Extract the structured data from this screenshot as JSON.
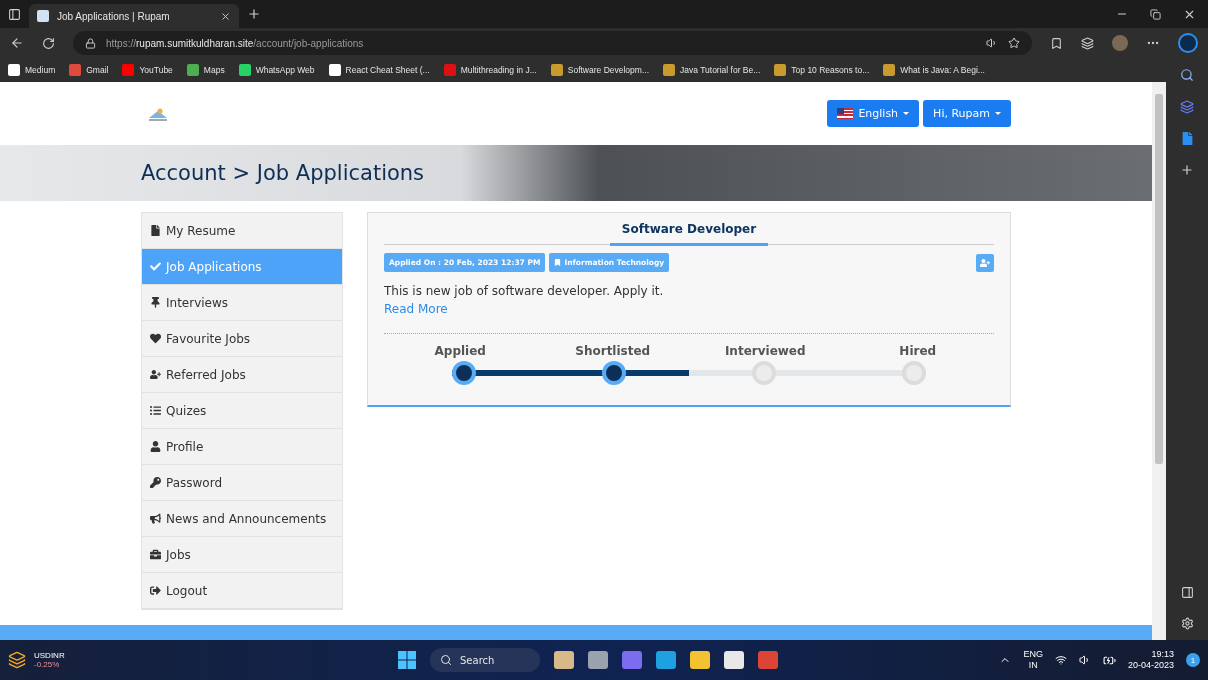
{
  "browser": {
    "tabs": [
      {
        "title": "Job Applications | Rupam",
        "selected": true
      }
    ],
    "url": {
      "scheme": "https://",
      "host": "rupam.sumitkuldharan.site",
      "path": "/account/job-applications"
    },
    "bookmarks": [
      "Medium",
      "Gmail",
      "YouTube",
      "Maps",
      "WhatsApp Web",
      "React Cheat Sheet (...",
      "Multithreading in J...",
      "Software Developm...",
      "Java Tutorial for Be...",
      "Top 10 Reasons to...",
      "What is Java: A Begi..."
    ]
  },
  "header": {
    "language": "English",
    "user": "Hi, Rupam"
  },
  "banner": {
    "breadcrumb": "Account > Job Applications"
  },
  "menu": [
    {
      "label": "My Resume",
      "selected": false
    },
    {
      "label": "Job Applications",
      "selected": true
    },
    {
      "label": "Interviews",
      "selected": false
    },
    {
      "label": "Favourite Jobs",
      "selected": false
    },
    {
      "label": "Referred Jobs",
      "selected": false
    },
    {
      "label": "Quizes",
      "selected": false
    },
    {
      "label": "Profile",
      "selected": false
    },
    {
      "label": "Password",
      "selected": false
    },
    {
      "label": "News and Announcements",
      "selected": false
    },
    {
      "label": "Jobs",
      "selected": false
    },
    {
      "label": "Logout",
      "selected": false
    }
  ],
  "application": {
    "title": "Software Developer",
    "applied_on": "Applied On : 20 Feb, 2023 12:37 PM",
    "category": "Information Technology",
    "description": "This is new job of software developer. Apply it.",
    "read_more": "Read More",
    "progress": {
      "level": 0.5
    },
    "steps": [
      {
        "label": "Applied",
        "done": true
      },
      {
        "label": "Shortlisted",
        "done": true
      },
      {
        "label": "Interviewed",
        "done": false
      },
      {
        "label": "Hired",
        "done": false
      }
    ]
  },
  "taskbar": {
    "ticker": {
      "symbol": "USDINR",
      "change": "-0.25%"
    },
    "search": "Search",
    "language": "ENG",
    "region": "IN",
    "time": "19:13",
    "date": "20-04-2023",
    "notifications": "1"
  }
}
